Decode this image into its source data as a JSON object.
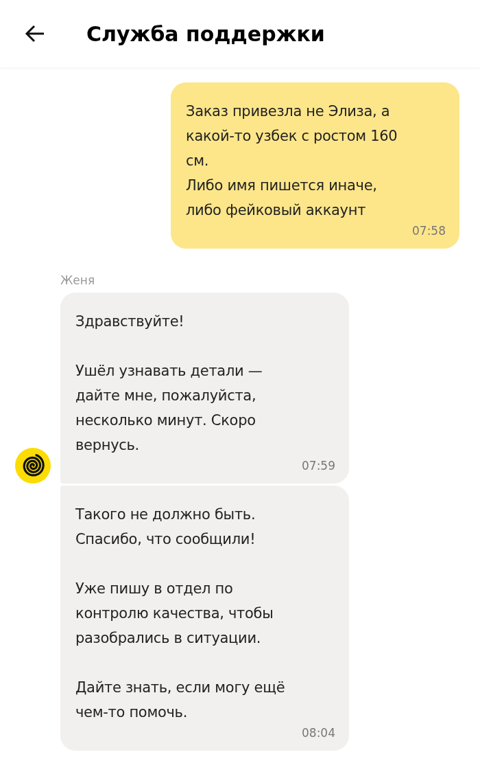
{
  "header": {
    "title": "Служба поддержки"
  },
  "messages": [
    {
      "kind": "outgoing",
      "text": "Заказ привезла не Элиза, а\nкакой-то узбек с ростом 160\nсм.\nЛибо имя пишется иначе,\nлибо фейковый аккаунт",
      "time": "07:58"
    }
  ],
  "incoming_group": {
    "sender": "Женя",
    "messages": [
      {
        "text": "Здравствуйте!\n\nУшёл узнавать детали —\nдайте мне, пожалуйста,\nнесколько минут. Скоро\nвернусь.",
        "time": "07:59",
        "avatar": true
      },
      {
        "text": "Такого не должно быть.\nСпасибо, что сообщили!\n\nУже пишу в отдел по\nконтролю качества, чтобы\nразобрались в ситуации.\n\nДайте знать, если могу ещё\nчем-то помочь.",
        "time": "08:04",
        "avatar": false
      }
    ]
  }
}
